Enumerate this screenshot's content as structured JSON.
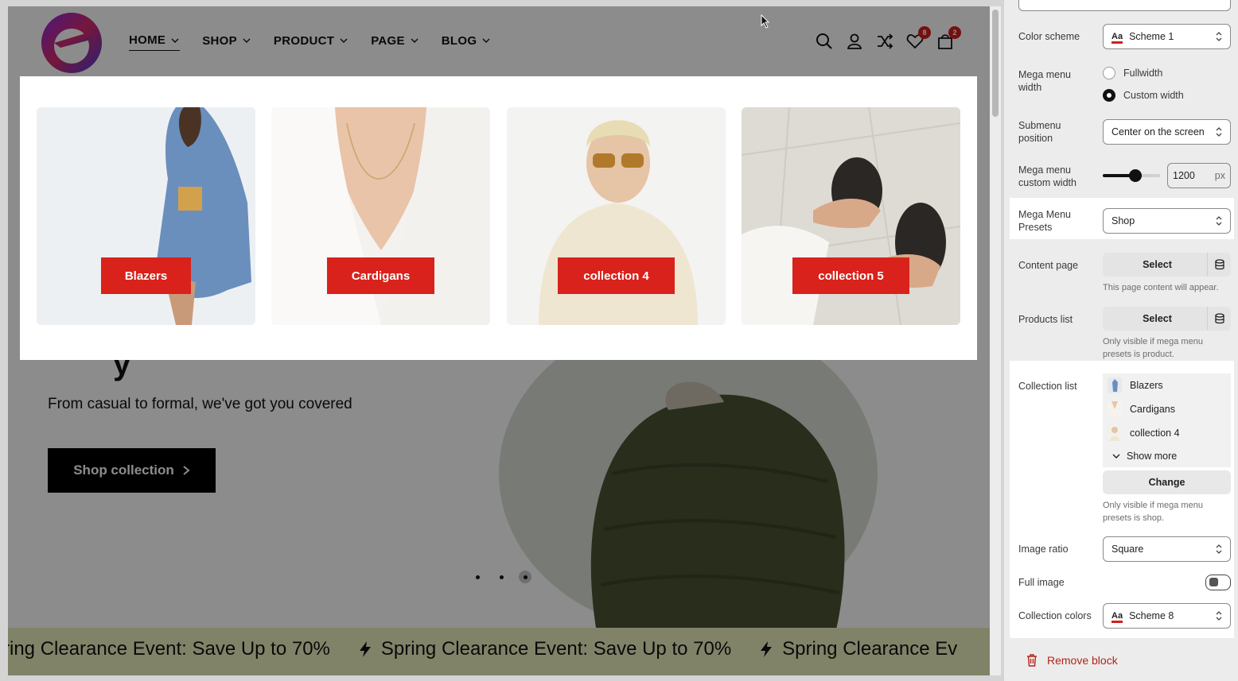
{
  "header": {
    "nav": [
      {
        "label": "HOME"
      },
      {
        "label": "SHOP"
      },
      {
        "label": "PRODUCT"
      },
      {
        "label": "PAGE"
      },
      {
        "label": "BLOG"
      }
    ],
    "wishlist_count": "8",
    "cart_count": "2"
  },
  "mega_menu": {
    "cards": [
      {
        "label": "Blazers"
      },
      {
        "label": "Cardigans"
      },
      {
        "label": "collection 4"
      },
      {
        "label": "collection 5"
      }
    ]
  },
  "hero": {
    "heading_fragment": "y",
    "subtitle": "From casual to formal, we've got you covered",
    "button_label": "Shop collection",
    "slides_total": 3,
    "active_slide": 3
  },
  "marquee": {
    "items": [
      "ring Clearance Event: Save Up to 70%",
      "Spring Clearance Event: Save Up to 70%",
      "Spring Clearance Ev"
    ]
  },
  "panel": {
    "color_scheme": {
      "label": "Color scheme",
      "value": "Scheme 1"
    },
    "mega_menu_width": {
      "label": "Mega menu width",
      "options": [
        "Fullwidth",
        "Custom width"
      ],
      "selected": "Custom width"
    },
    "submenu_position": {
      "label": "Submenu position",
      "value": "Center on the screen"
    },
    "custom_width": {
      "label": "Mega menu custom width",
      "value": "1200",
      "unit": "px",
      "slider_fraction": 0.57
    },
    "presets": {
      "label": "Mega Menu Presets",
      "value": "Shop"
    },
    "content_page": {
      "label": "Content page",
      "button": "Select",
      "hint": "This page content will appear."
    },
    "products_list": {
      "label": "Products list",
      "button": "Select",
      "hint": "Only visible if mega menu presets is product."
    },
    "collection_list": {
      "label": "Collection list",
      "items": [
        "Blazers",
        "Cardigans",
        "collection 4"
      ],
      "show_more": "Show more",
      "change": "Change",
      "hint": "Only visible if mega menu presets is shop."
    },
    "image_ratio": {
      "label": "Image ratio",
      "value": "Square"
    },
    "full_image": {
      "label": "Full image",
      "enabled": false
    },
    "collection_colors": {
      "label": "Collection colors",
      "value": "Scheme 8"
    },
    "remove_block": "Remove block"
  },
  "colors": {
    "accent_red": "#d8221b",
    "marquee_bg": "#ecefbf",
    "hero_circle": "#d9dfd5",
    "panel_bg": "#ececec"
  },
  "icons": [
    "search-icon",
    "user-icon",
    "shuffle-icon",
    "heart-icon",
    "cart-icon",
    "chevron-down-icon",
    "lightning-icon",
    "database-icon",
    "trash-icon"
  ]
}
